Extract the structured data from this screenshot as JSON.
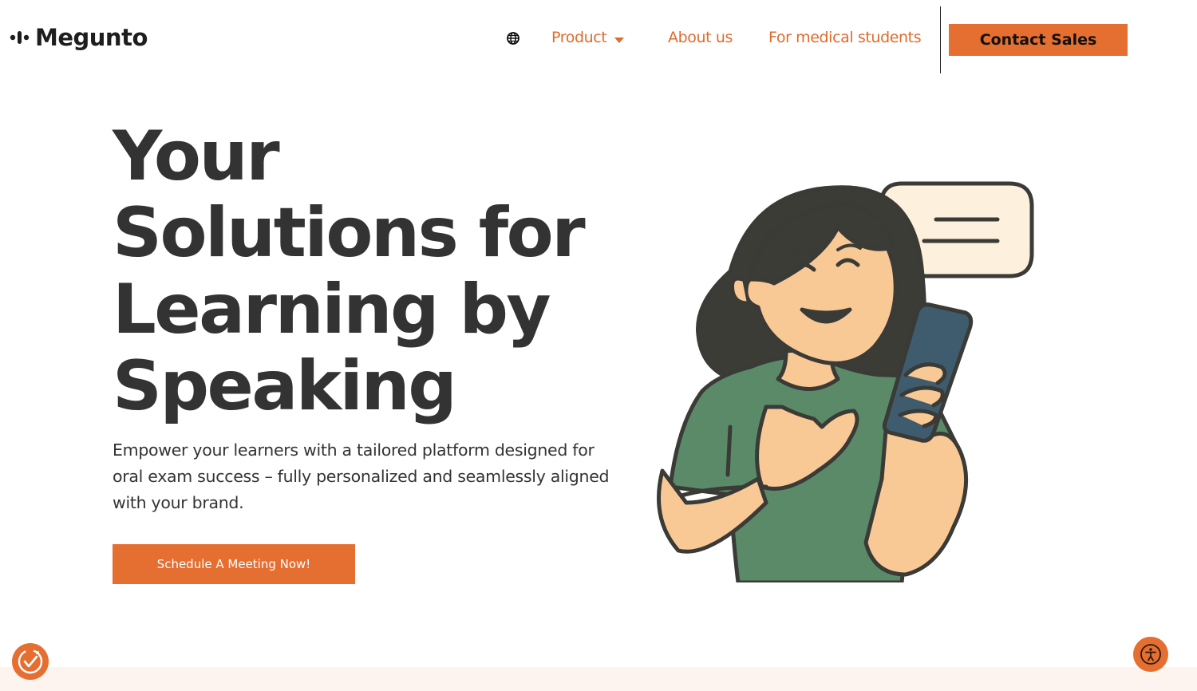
{
  "brand": {
    "name": "Megunto",
    "logo_color": "#1e1e1e"
  },
  "nav": {
    "language_icon": "globe-icon",
    "items": [
      {
        "label": "Product",
        "has_dropdown": true
      },
      {
        "label": "About us"
      },
      {
        "label": "For medical students"
      }
    ],
    "cta_label": "Contact Sales"
  },
  "hero": {
    "title_lines": [
      "Your",
      "Solutions for",
      "Learning by",
      "Speaking"
    ],
    "subtitle": "Empower your learners with a tailored platform designed for oral exam success – fully personalized and seamlessly aligned with your brand.",
    "cta_label": "Schedule A Meeting Now!"
  },
  "widgets": {
    "cookie_icon": "cookie-consent-icon",
    "accessibility_icon": "accessibility-icon"
  },
  "colors": {
    "accent": "#e56e31",
    "nav_text": "#e06b2c",
    "heading": "#333333",
    "shirt": "#5b8a68",
    "skin": "#f9c995",
    "hair": "#3c3c36",
    "bubble": "#fdf0dc",
    "phone": "#3f5c6e"
  }
}
